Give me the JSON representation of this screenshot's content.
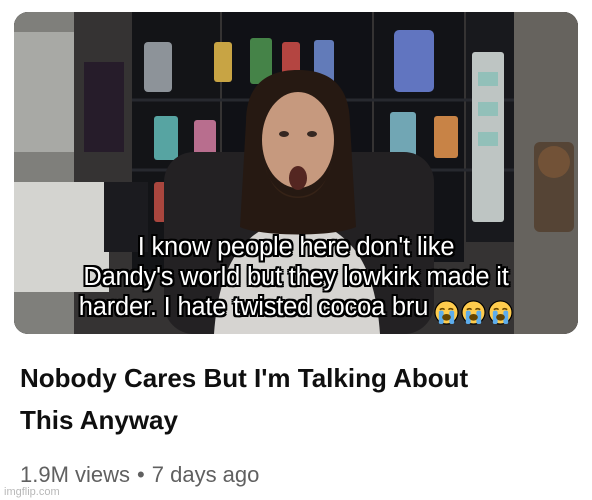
{
  "thumbnail": {
    "caption_lines": [
      "I know people here don't like",
      "Dandy's world but they lowkirk made it",
      "harder. I hate twisted cocoa bru"
    ],
    "caption_emoji": [
      "loudly-crying-face-icon",
      "loudly-crying-face-icon",
      "loudly-crying-face-icon"
    ]
  },
  "video": {
    "title_line1": "Nobody Cares But I'm Talking About",
    "title_line2": "This Anyway",
    "views": "1.9M views",
    "separator": "•",
    "age": "7 days ago"
  },
  "watermark": "imgflip.com",
  "colors": {
    "title_text": "#0f0f0f",
    "meta_text": "#606060",
    "caption_text": "#ffffff",
    "caption_outline": "#000000"
  }
}
